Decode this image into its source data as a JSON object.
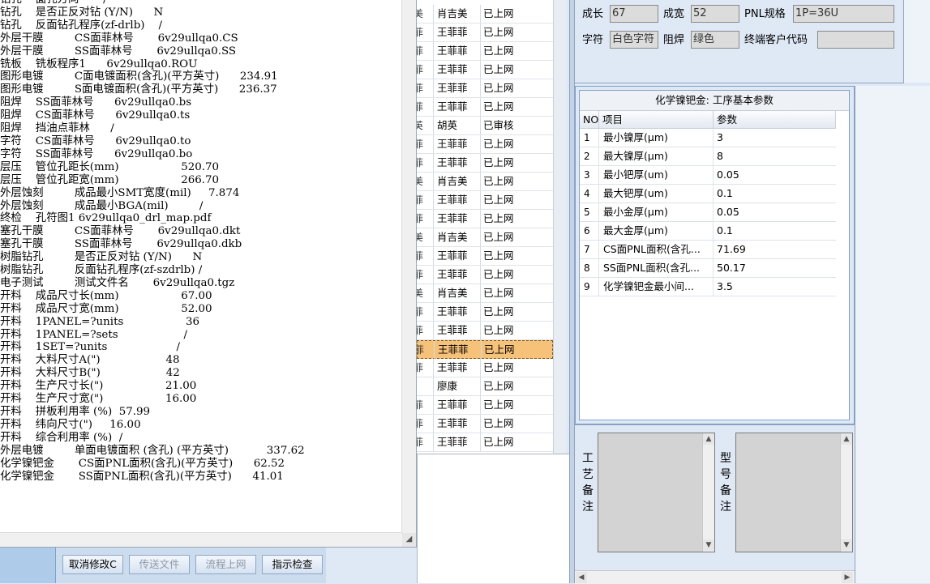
{
  "notepad": {
    "lines": [
      "钻孔    面孔方向       /",
      "钻孔    是否正反对钻 (Y/N)      N",
      "钻孔    反面钻孔程序(zf-drlb)    /",
      "外层干膜         CS面菲林号       6v29ullqa0.CS",
      "外层干膜         SS面菲林号       6v29ullqa0.SS",
      "铣板    铣板程序1      6v29ullqa0.ROU",
      "图形电镀         C面电镀面积(含孔)(平方英寸)      234.91",
      "图形电镀         S面电镀面积(含孔)(平方英寸)      236.37",
      "阻焊    SS面菲林号      6v29ullqa0.bs",
      "阻焊    CS面菲林号      6v29ullqa0.ts",
      "阻焊    挡油点菲林      /",
      "字符    CS面菲林号      6v29ullqa0.to",
      "字符    SS面菲林号      6v29ullqa0.bo",
      "层压    管位孔距长(mm)                  520.70",
      "层压    管位孔距宽(mm)                  266.70",
      "外层蚀刻         成品最小SMT宽度(mil)     7.874",
      "外层蚀刻         成品最小BGA(mil)         /",
      "终检    孔符图1 6v29ullqa0_drl_map.pdf",
      "塞孔干膜         CS面菲林号       6v29ullqa0.dkt",
      "塞孔干膜         SS面菲林号       6v29ullqa0.dkb",
      "树脂钻孔         是否正反对钻 (Y/N)      N",
      "树脂钻孔         反面钻孔程序(zf-szdrlb) /",
      "电子测试         测试文件名       6v29ullqa0.tgz",
      "开料    成品尺寸长(mm)                  67.00",
      "开料    成品尺寸宽(mm)                  52.00",
      "开料    1PANEL=?units                  36",
      "开料    1PANEL=?sets                   /",
      "开料    1SET=?units                    /",
      "开料    大料尺寸A(\")                   48",
      "开料    大料尺寸B(\")                   42",
      "开料    生产尺寸长(\")                  21.00",
      "开料    生产尺寸宽(\")                  16.00",
      "开料    拼板利用率 (%)  57.99",
      "开料    纬向尺寸(\")     16.00",
      "开料    综合利用率 (%)  /",
      "外层电镀         单面电镀面积 (含孔) (平方英寸)           337.62",
      "化学镍钯金       CS面PNL面积(含孔)(平方英寸)      62.52",
      "化学镍钯金       SS面PNL面积(含孔)(平方英寸)      41.01"
    ]
  },
  "grid": {
    "rows": [
      {
        "c0": "美",
        "name": "肖吉美",
        "status": "已上网"
      },
      {
        "c0": "菲",
        "name": "王菲菲",
        "status": "已上网"
      },
      {
        "c0": "菲",
        "name": "王菲菲",
        "status": "已上网"
      },
      {
        "c0": "菲",
        "name": "王菲菲",
        "status": "已上网"
      },
      {
        "c0": "菲",
        "name": "王菲菲",
        "status": "已上网"
      },
      {
        "c0": "菲",
        "name": "王菲菲",
        "status": "已上网"
      },
      {
        "c0": "英",
        "name": "胡英",
        "status": "已审核"
      },
      {
        "c0": "菲",
        "name": "王菲菲",
        "status": "已上网"
      },
      {
        "c0": "菲",
        "name": "王菲菲",
        "status": "已上网"
      },
      {
        "c0": "美",
        "name": "肖吉美",
        "status": "已上网"
      },
      {
        "c0": "菲",
        "name": "王菲菲",
        "status": "已上网"
      },
      {
        "c0": "菲",
        "name": "王菲菲",
        "status": "已上网"
      },
      {
        "c0": "美",
        "name": "肖吉美",
        "status": "已上网"
      },
      {
        "c0": "菲",
        "name": "王菲菲",
        "status": "已上网"
      },
      {
        "c0": "菲",
        "name": "王菲菲",
        "status": "已上网"
      },
      {
        "c0": "美",
        "name": "肖吉美",
        "status": "已上网"
      },
      {
        "c0": "菲",
        "name": "王菲菲",
        "status": "已上网"
      },
      {
        "c0": "菲",
        "name": "王菲菲",
        "status": "已上网"
      },
      {
        "c0": "菲",
        "name": "王菲菲",
        "status": "已上网"
      },
      {
        "c0": "菲",
        "name": "王菲菲",
        "status": "已上网"
      },
      {
        "c0": "",
        "name": "廖康",
        "status": "已上网"
      },
      {
        "c0": "菲",
        "name": "王菲菲",
        "status": "已上网"
      },
      {
        "c0": "菲",
        "name": "王菲菲",
        "status": "已上网"
      },
      {
        "c0": "菲",
        "name": "王菲菲",
        "status": "已上网"
      }
    ],
    "selected_index": 18
  },
  "toolbar": {
    "cancel_label": "取消修改C",
    "transfer_label": "传送文件",
    "flow_label": "流程上网",
    "check_label": "指示检查"
  },
  "form": {
    "length_label": "成长",
    "length_value": "67",
    "width_label": "成宽",
    "width_value": "52",
    "pnl_label": "PNL规格",
    "pnl_value": "1P=36U",
    "char_label": "字符",
    "char_value": "白色字符",
    "mask_label": "阻焊",
    "mask_value": "绿色",
    "customer_label": "终端客户代码",
    "customer_value": ""
  },
  "params": {
    "title": "化学镍钯金: 工序基本参数",
    "headers": {
      "no": "NO",
      "item": "项目",
      "value": "参数"
    },
    "rows": [
      {
        "no": "1",
        "item": "最小镍厚(μm)",
        "value": "3"
      },
      {
        "no": "2",
        "item": "最大镍厚(μm)",
        "value": "8"
      },
      {
        "no": "3",
        "item": "最小钯厚(um)",
        "value": "0.05"
      },
      {
        "no": "4",
        "item": "最大钯厚(um)",
        "value": "0.1"
      },
      {
        "no": "5",
        "item": "最小金厚(μm)",
        "value": "0.05"
      },
      {
        "no": "6",
        "item": "最大金厚(μm)",
        "value": "0.1"
      },
      {
        "no": "7",
        "item": "CS面PNL面积(含孔...",
        "value": "71.69"
      },
      {
        "no": "8",
        "item": "SS面PNL面积(含孔...",
        "value": "50.17"
      },
      {
        "no": "9",
        "item": "化学镍钯金最小间...",
        "value": "3.5"
      }
    ]
  },
  "remarks": {
    "process_label": "工艺备注",
    "model_label": "型号备注"
  },
  "colors": {
    "selected_row": "#f6c27a",
    "panel_bg": "#dfe8f5",
    "field_bg": "#dcdcdc"
  }
}
